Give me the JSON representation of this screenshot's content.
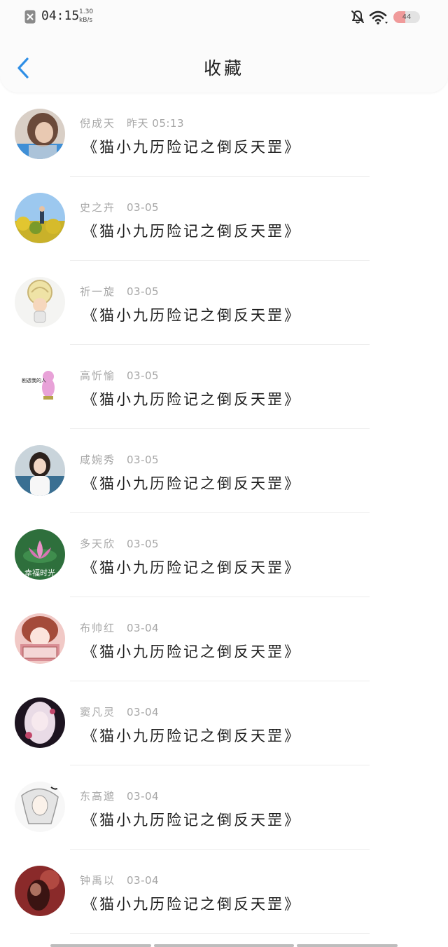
{
  "status_bar": {
    "time": "04:15",
    "speed_value": "1.30",
    "speed_unit": "kB/s",
    "battery_level": "44",
    "battery_fraction": 0.44,
    "icons": [
      "close-box-icon",
      "bell-muted-icon",
      "wifi-icon",
      "battery-icon"
    ]
  },
  "header": {
    "title": "收藏",
    "back_icon": "chevron-left-icon"
  },
  "colors": {
    "accent": "#2f8fe6",
    "meta_text": "#a6a6a6",
    "title_text": "#1c1c1c",
    "battery_fill": "#f09a9a"
  },
  "favorites": [
    {
      "user": "倪成天",
      "date": "昨天 05:13",
      "title": "《猫小九历险记之倒反天罡》",
      "avatar": "avatar-woman-photo"
    },
    {
      "user": "史之卉",
      "date": "03-05",
      "title": "《猫小九历险记之倒反天罡》",
      "avatar": "avatar-field-photo"
    },
    {
      "user": "祈一旋",
      "date": "03-05",
      "title": "《猫小九历险记之倒反天罡》",
      "avatar": "avatar-cartoon-curly"
    },
    {
      "user": "高忻愉",
      "date": "03-05",
      "title": "《猫小九历险记之倒反天罡》",
      "avatar": "avatar-pink-doodle"
    },
    {
      "user": "咸婉秀",
      "date": "03-05",
      "title": "《猫小九历险记之倒反天罡》",
      "avatar": "avatar-girl-photo"
    },
    {
      "user": "多天欣",
      "date": "03-05",
      "title": "《猫小九历险记之倒反天罡》",
      "avatar": "avatar-lotus",
      "avatar_caption": "幸福时光"
    },
    {
      "user": "布帅红",
      "date": "03-04",
      "title": "《猫小九历险记之倒反天罡》",
      "avatar": "avatar-anime-comic"
    },
    {
      "user": "窦凡灵",
      "date": "03-04",
      "title": "《猫小九历险记之倒反天罡》",
      "avatar": "avatar-anime-girl"
    },
    {
      "user": "东高邈",
      "date": "03-04",
      "title": "《猫小九历险记之倒反天罡》",
      "avatar": "avatar-white-hair"
    },
    {
      "user": "钟禹以",
      "date": "03-04",
      "title": "《猫小九历险记之倒反天罡》",
      "avatar": "avatar-dark-red"
    }
  ]
}
